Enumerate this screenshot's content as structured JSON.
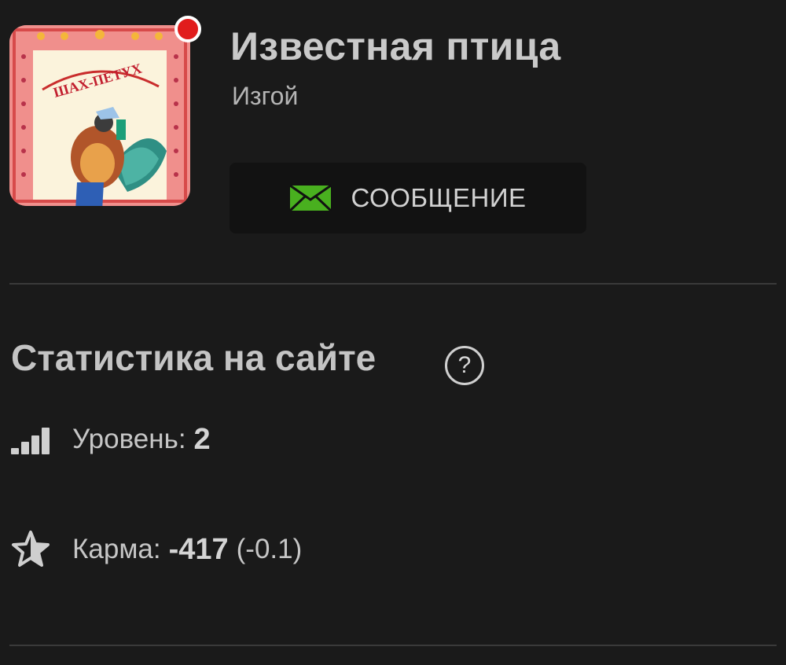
{
  "profile": {
    "name": "Известная птица",
    "status": "Изгой",
    "avatar_caption": "ШАХ-ПЕТУХ",
    "online": true
  },
  "actions": {
    "message_label": "СООБЩЕНИЕ",
    "message_icon": "envelope-icon"
  },
  "stats": {
    "title": "Статистика на сайте",
    "help_glyph": "?",
    "level_label": "Уровень:",
    "level_value": "2",
    "karma_label": "Карма:",
    "karma_value": "-417",
    "karma_delta": "(-0.1)"
  },
  "colors": {
    "background": "#1a1a1a",
    "online_dot": "#e11c1c",
    "message_icon_green": "#49b01f"
  }
}
